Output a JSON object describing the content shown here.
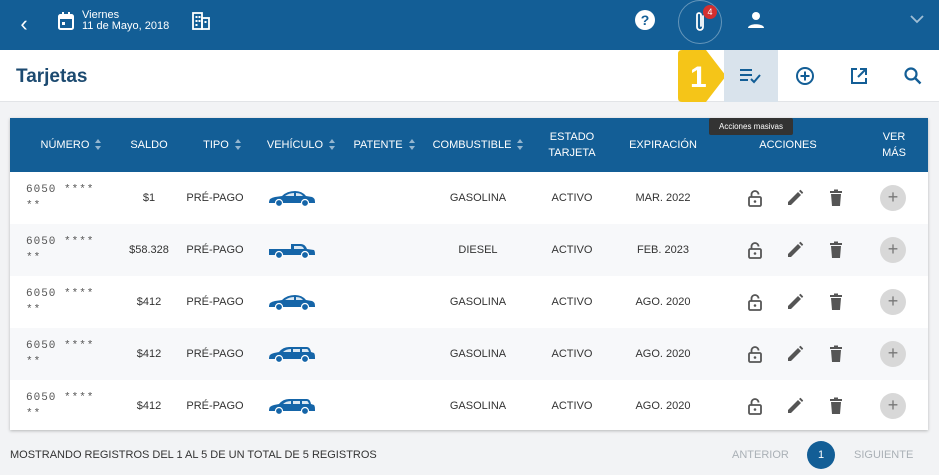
{
  "header": {
    "day": "Viernes",
    "date": "11 de Mayo, 2018",
    "notifications_count": "4",
    "help_label": "?"
  },
  "page": {
    "title": "Tarjetas",
    "step_number": "1",
    "tooltip": "Acciones masivas"
  },
  "table": {
    "columns": [
      "NÚMERO",
      "SALDO",
      "TIPO",
      "VEHÍCULO",
      "PATENTE",
      "COMBUSTIBLE",
      "ESTADO TARJETA",
      "EXPIRACIÓN",
      "ACCIONES",
      "VER MÁS"
    ],
    "rows": [
      {
        "numero": "6050 **** **",
        "saldo": "$1",
        "tipo": "PRÉ-PAGO",
        "vehiculo": "sedan-icon",
        "patente": "",
        "combustible": "GASOLINA",
        "estado": "ACTIVO",
        "expiracion": "MAR. 2022"
      },
      {
        "numero": "6050 **** **",
        "saldo": "$58.328",
        "tipo": "PRÉ-PAGO",
        "vehiculo": "pickup-icon",
        "patente": "",
        "combustible": "DIESEL",
        "estado": "ACTIVO",
        "expiracion": "FEB. 2023"
      },
      {
        "numero": "6050 **** **",
        "saldo": "$412",
        "tipo": "PRÉ-PAGO",
        "vehiculo": "sedan-icon",
        "patente": "",
        "combustible": "GASOLINA",
        "estado": "ACTIVO",
        "expiracion": "AGO. 2020"
      },
      {
        "numero": "6050 **** **",
        "saldo": "$412",
        "tipo": "PRÉ-PAGO",
        "vehiculo": "wagon-icon",
        "patente": "",
        "combustible": "GASOLINA",
        "estado": "ACTIVO",
        "expiracion": "AGO. 2020"
      },
      {
        "numero": "6050 **** **",
        "saldo": "$412",
        "tipo": "PRÉ-PAGO",
        "vehiculo": "wagon-icon",
        "patente": "",
        "combustible": "GASOLINA",
        "estado": "ACTIVO",
        "expiracion": "AGO. 2020"
      }
    ]
  },
  "footer": {
    "summary": "MOSTRANDO REGISTROS DEL 1 AL 5 DE UN TOTAL DE 5 REGISTROS",
    "prev": "ANTERIOR",
    "page": "1",
    "next": "SIGUIENTE"
  },
  "colors": {
    "primary": "#135e96",
    "highlight": "#f5c518",
    "vehicle": "#1565a8"
  }
}
